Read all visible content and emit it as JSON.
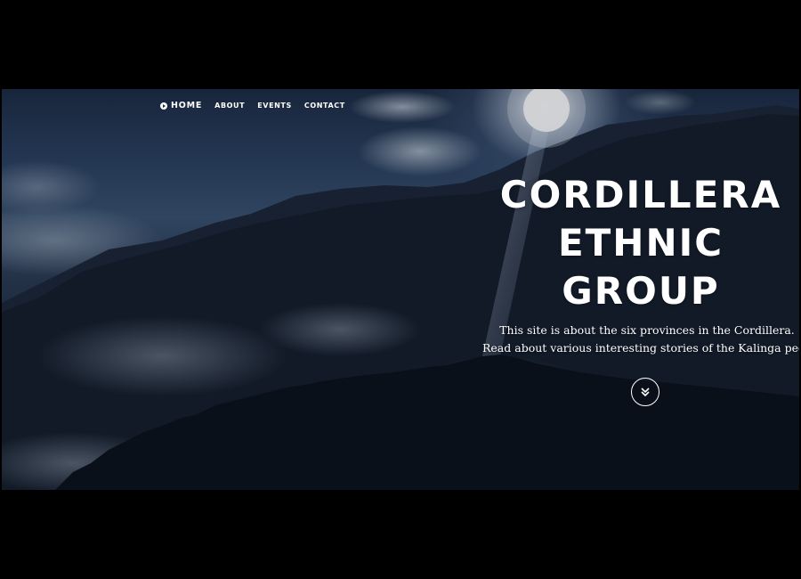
{
  "nav": {
    "items": [
      {
        "label": "HOME",
        "icon": "play-circle-icon",
        "active": true
      },
      {
        "label": "ABOUT"
      },
      {
        "label": "EVENTS"
      },
      {
        "label": "CONTACT"
      }
    ]
  },
  "hero": {
    "title_lines": [
      "CORDILLERA",
      "ETHNIC",
      "GROUP"
    ],
    "subtitle_lines": [
      "This site is about the six provinces in the Cordillera.",
      "Read about various interesting stories of the Kalinga people."
    ],
    "scroll_icon": "chevron-double-down-icon"
  },
  "colors": {
    "page_background": "#000000",
    "text": "#ffffff",
    "sky": "#2b4160",
    "mountain": "#131c29"
  }
}
